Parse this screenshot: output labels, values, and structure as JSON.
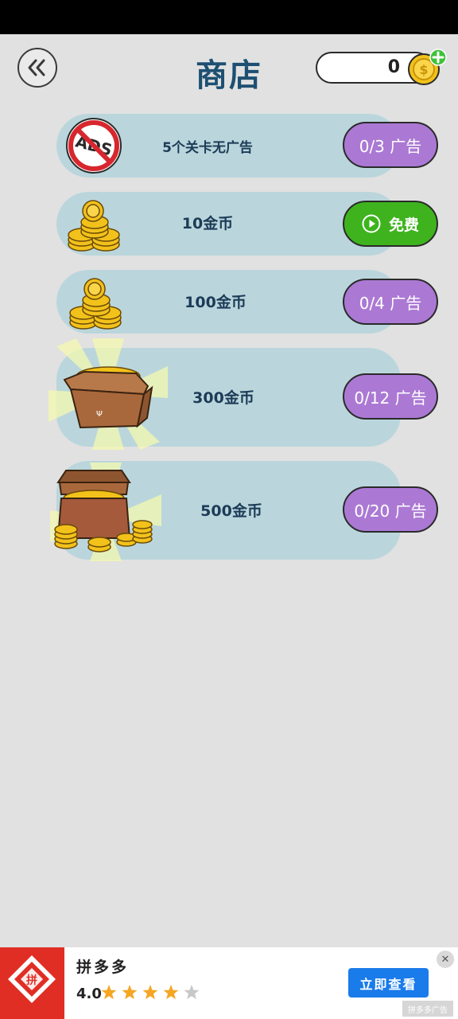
{
  "header": {
    "title": "商店",
    "coin_count": "0"
  },
  "shop_items": [
    {
      "label": "5个关卡无广告",
      "button": "0/3 广告",
      "icon": "no-ads-icon"
    },
    {
      "label": "10金币",
      "button": "免费",
      "icon": "coin-stack-icon"
    },
    {
      "label": "100金币",
      "button": "0/4 广告",
      "icon": "coin-stack-icon"
    },
    {
      "label": "300金币",
      "button": "0/12 广告",
      "icon": "coin-box-icon"
    },
    {
      "label": "500金币",
      "button": "0/20 广告",
      "icon": "treasure-chest-icon"
    }
  ],
  "ad_banner": {
    "app_name": "拼多多",
    "rating": "4.0",
    "stars": 4,
    "cta": "立即查看",
    "tag": "拼多多广告"
  },
  "colors": {
    "background": "#e1e1e1",
    "card": "#bad6dc",
    "title": "#1d4f72",
    "ad_button": "#ab79d4",
    "free_button": "#3eb31e",
    "cta": "#1a7bea"
  }
}
